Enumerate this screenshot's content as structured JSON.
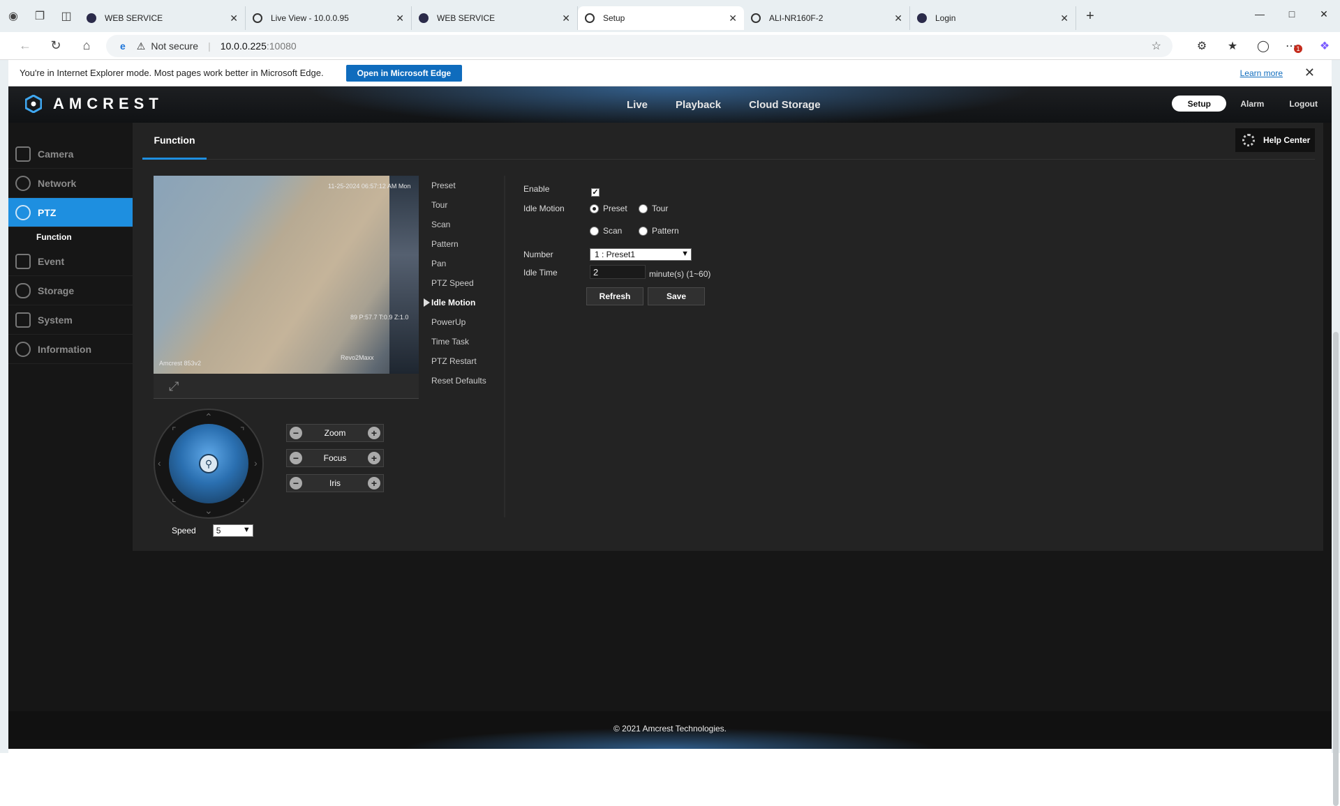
{
  "browser": {
    "tabs": [
      {
        "title": "WEB SERVICE",
        "icon": "globe-icon"
      },
      {
        "title": "Live View - 10.0.0.95",
        "icon": "ie-icon"
      },
      {
        "title": "WEB SERVICE",
        "icon": "globe-icon"
      },
      {
        "title": "Setup",
        "icon": "ie-icon",
        "active": true
      },
      {
        "title": "ALI-NR160F-2",
        "icon": "ie-icon"
      },
      {
        "title": "Login",
        "icon": "globe-icon"
      }
    ],
    "address": {
      "security": "Not secure",
      "host": "10.0.0.225",
      "port": ":10080"
    },
    "ie_bar": {
      "message": "You're in Internet Explorer mode. Most pages work better in Microsoft Edge.",
      "open_button": "Open in Microsoft Edge",
      "learn_more": "Learn more"
    },
    "notification_count": "1"
  },
  "app": {
    "brand": "AMCREST",
    "top_nav": [
      "Live",
      "Playback",
      "Cloud Storage"
    ],
    "top_right": {
      "setup": "Setup",
      "alarm": "Alarm",
      "logout": "Logout"
    },
    "sidebar": [
      {
        "label": "Camera"
      },
      {
        "label": "Network"
      },
      {
        "label": "PTZ",
        "active": true
      },
      {
        "label": "Event"
      },
      {
        "label": "Storage"
      },
      {
        "label": "System"
      },
      {
        "label": "Information"
      }
    ],
    "sidebar_sub": "Function",
    "panel_tab": "Function",
    "help_center": "Help Center",
    "video": {
      "timestamp": "11-25-2024 06:57:12 AM Mon",
      "ptz_readout": "89   P:57.7 T:0.9 Z:1.0",
      "camera_name": "Amcrest 853v2",
      "channel": "Revo2Maxx"
    },
    "ptz_controls": [
      {
        "label": "Zoom"
      },
      {
        "label": "Focus"
      },
      {
        "label": "Iris"
      }
    ],
    "speed_label": "Speed",
    "speed_value": "5",
    "function_menu": [
      "Preset",
      "Tour",
      "Scan",
      "Pattern",
      "Pan",
      "PTZ Speed",
      "Idle Motion",
      "PowerUp",
      "Time Task",
      "PTZ Restart",
      "Reset Defaults"
    ],
    "function_menu_active": "Idle Motion",
    "form": {
      "enable_label": "Enable",
      "enable_checked": true,
      "idle_motion_label": "Idle Motion",
      "options": [
        "Preset",
        "Tour",
        "Scan",
        "Pattern"
      ],
      "selected_option": "Preset",
      "number_label": "Number",
      "number_value": "1 : Preset1",
      "idle_time_label": "Idle Time",
      "idle_time_value": "2",
      "idle_time_unit": "minute(s) (1~60)",
      "refresh_button": "Refresh",
      "save_button": "Save"
    },
    "footer": "© 2021 Amcrest Technologies."
  }
}
